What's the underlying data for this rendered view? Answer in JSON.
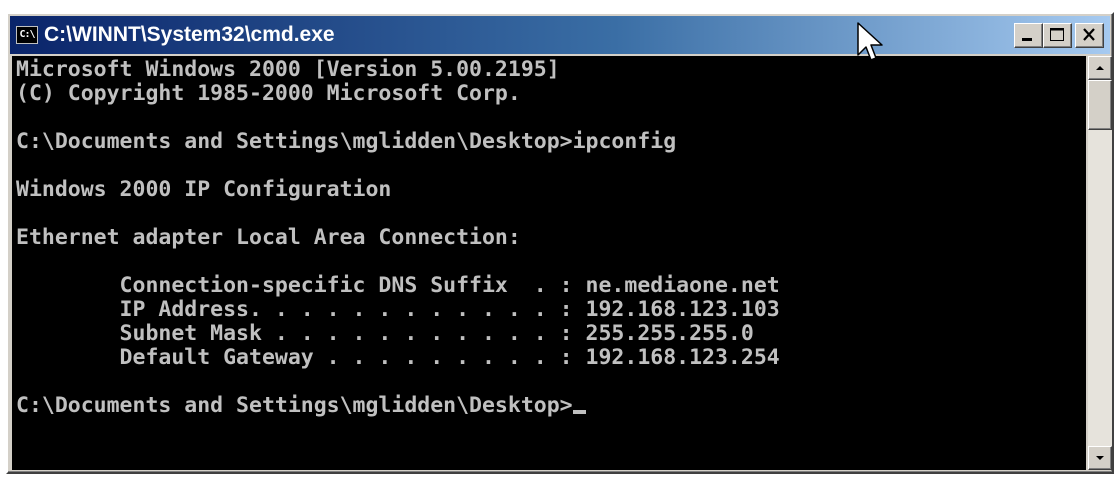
{
  "window": {
    "title": "C:\\WINNT\\System32\\cmd.exe",
    "icon": "console-icon",
    "icon_label": "C:\\",
    "caption_buttons": [
      "minimize",
      "maximize",
      "close"
    ]
  },
  "console": {
    "lines": [
      "Microsoft Windows 2000 [Version 5.00.2195]",
      "(C) Copyright 1985-2000 Microsoft Corp.",
      "",
      "C:\\Documents and Settings\\mglidden\\Desktop>ipconfig",
      "",
      "Windows 2000 IP Configuration",
      "",
      "Ethernet adapter Local Area Connection:",
      "",
      "        Connection-specific DNS Suffix  . : ne.mediaone.net",
      "        IP Address. . . . . . . . . . . . : 192.168.123.103",
      "        Subnet Mask . . . . . . . . . . . : 255.255.255.0",
      "        Default Gateway . . . . . . . . . : 192.168.123.254",
      "",
      "C:\\Documents and Settings\\mglidden\\Desktop>"
    ],
    "text_color": "#c0c0c0",
    "background_color": "#000000"
  },
  "colors": {
    "titlebar_start": "#0a246a",
    "titlebar_end": "#a6caf0",
    "chrome": "#d4d0c8"
  }
}
